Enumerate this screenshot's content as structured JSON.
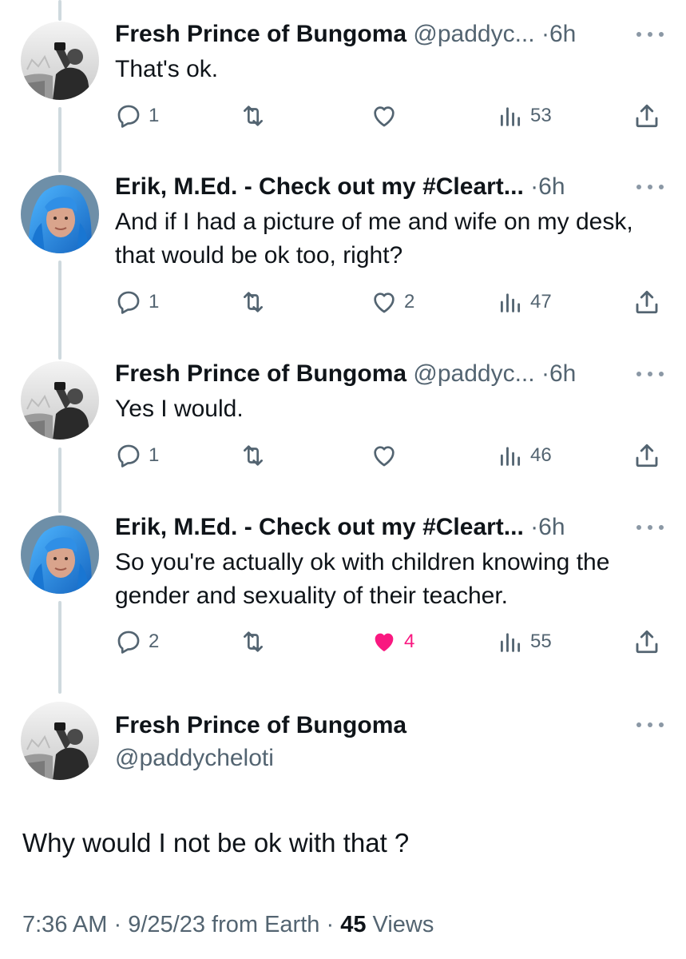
{
  "colors": {
    "text_primary": "#0f1419",
    "text_secondary": "#536471",
    "like_active": "#f91880",
    "thread_line": "#cfd9de"
  },
  "replies": [
    {
      "display_name": "Fresh Prince of Bungoma",
      "handle": "@paddyc...",
      "time": "6h",
      "text": "That's ok.",
      "reply_count": "1",
      "retweet_count": "",
      "like_count": "",
      "liked": false,
      "view_count": "53",
      "avatar": "grayscale-man-photo"
    },
    {
      "display_name": "Erik, M.Ed. - Check out my #Cleart...",
      "handle": "",
      "time": "6h",
      "text": "And if I had a picture of me and wife on my desk, that would be ok too, right?",
      "reply_count": "1",
      "retweet_count": "",
      "like_count": "2",
      "liked": false,
      "view_count": "47",
      "avatar": "blue-hair-person-photo"
    },
    {
      "display_name": "Fresh Prince of Bungoma",
      "handle": "@paddyc...",
      "time": "6h",
      "text": "Yes I would.",
      "reply_count": "1",
      "retweet_count": "",
      "like_count": "",
      "liked": false,
      "view_count": "46",
      "avatar": "grayscale-man-photo"
    },
    {
      "display_name": "Erik, M.Ed. - Check out my #Cleart...",
      "handle": "",
      "time": "6h",
      "text": "So you're actually ok with children knowing the gender and sexuality of their teacher.",
      "reply_count": "2",
      "retweet_count": "",
      "like_count": "4",
      "liked": true,
      "view_count": "55",
      "avatar": "blue-hair-person-photo"
    }
  ],
  "main_tweet": {
    "display_name": "Fresh Prince of Bungoma",
    "handle": "@paddycheloti",
    "text": "Why would I not be ok with that ?",
    "time": "7:36 AM",
    "date": "9/25/23",
    "source": "from Earth",
    "views_count": "45",
    "views_label": "Views",
    "separator": "·"
  }
}
